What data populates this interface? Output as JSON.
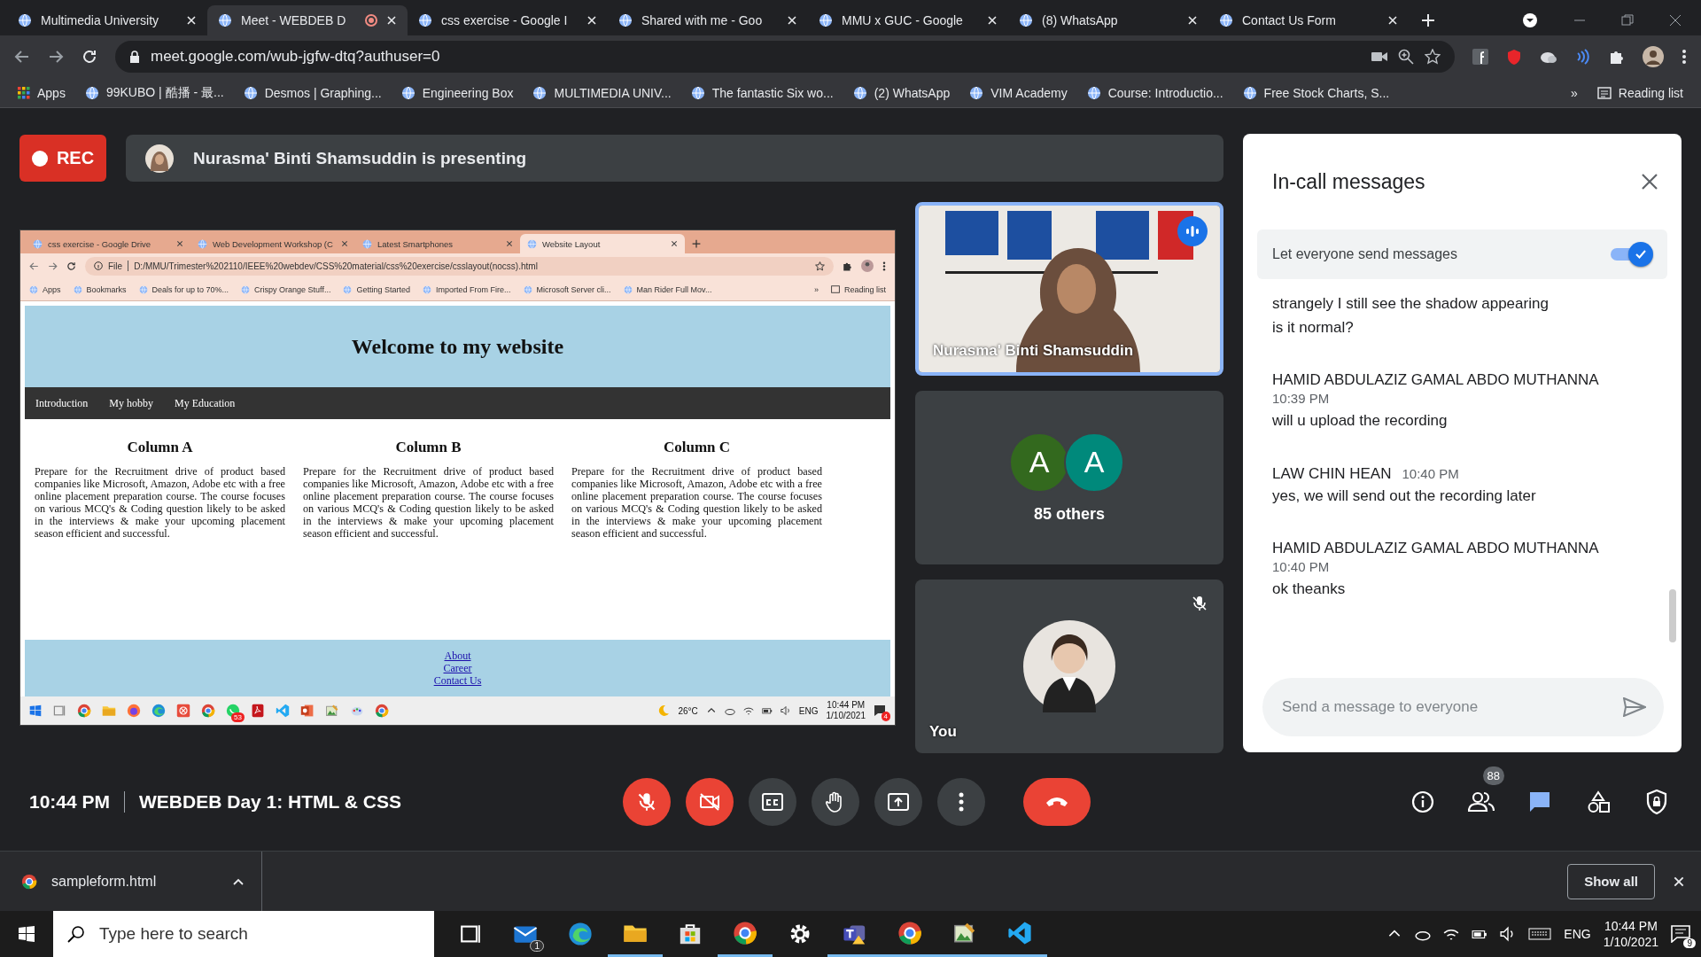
{
  "browser": {
    "tabs": [
      {
        "title": "Multimedia University",
        "selected": false,
        "recording": false
      },
      {
        "title": "Meet - WEBDEB D",
        "selected": true,
        "recording": true
      },
      {
        "title": "css exercise - Google I",
        "selected": false,
        "recording": false
      },
      {
        "title": "Shared with me - Goo",
        "selected": false,
        "recording": false
      },
      {
        "title": "MMU x GUC - Google",
        "selected": false,
        "recording": false
      },
      {
        "title": "(8) WhatsApp",
        "selected": false,
        "recording": false
      },
      {
        "title": "Contact Us Form",
        "selected": false,
        "recording": false
      }
    ],
    "address": "meet.google.com/wub-jgfw-dtq?authuser=0",
    "bookmarks": [
      "Apps",
      "99KUBO | 酷播 - 最...",
      "Desmos | Graphing...",
      "Engineering Box",
      "MULTIMEDIA UNIV...",
      "The fantastic Six wo...",
      "(2) WhatsApp",
      "VIM Academy",
      "Course: Introductio...",
      "Free Stock Charts, S..."
    ],
    "more": "»",
    "reading_list": "Reading list"
  },
  "meet": {
    "recording_label": "REC",
    "presenter_banner": "Nurasma' Binti Shamsuddin is presenting",
    "shared_screen": {
      "tabs": [
        {
          "title": "css exercise - Google Drive",
          "selected": false
        },
        {
          "title": "Web Development Workshop (C",
          "selected": false
        },
        {
          "title": "Latest Smartphones",
          "selected": false
        },
        {
          "title": "Website Layout",
          "selected": true
        }
      ],
      "scheme": "File",
      "address": "D:/MMU/Trimester%202110/IEEE%20webdev/CSS%20material/css%20exercise/csslayout(nocss).html",
      "bookmarks": [
        "Apps",
        "Bookmarks",
        "Deals for up to 70%...",
        "Crispy Orange Stuff...",
        "Getting Started",
        "Imported From Fire...",
        "Microsoft Server cli...",
        "Man Rider Full Mov..."
      ],
      "more": "»",
      "reading_list": "Reading list",
      "heading": "Welcome to my website",
      "nav": [
        "Introduction",
        "My hobby",
        "My Education"
      ],
      "columns": [
        {
          "title": "Column A",
          "text": "Prepare for the Recruitment drive of product based companies like Microsoft, Amazon, Adobe etc with a free online placement preparation course. The course focuses on various MCQ's & Coding question likely to be asked in the interviews & make your upcoming placement season efficient and successful."
        },
        {
          "title": "Column B",
          "text": "Prepare for the Recruitment drive of product based companies like Microsoft, Amazon, Adobe etc with a free online placement preparation course. The course focuses on various MCQ's & Coding question likely to be asked in the interviews & make your upcoming placement season efficient and successful."
        },
        {
          "title": "Column C",
          "text": "Prepare for the Recruitment drive of product based companies like Microsoft, Amazon, Adobe etc with a free online placement preparation course. The course focuses on various MCQ's & Coding question likely to be asked in the interviews & make your upcoming placement season efficient and successful."
        }
      ],
      "footer_links": [
        "About",
        "Career",
        "Contact Us"
      ],
      "taskbar": {
        "badge": "53",
        "weather": "26°C",
        "language": "ENG",
        "time": "10:44 PM",
        "date": "1/10/2021",
        "notifications": "4"
      }
    },
    "tiles": [
      {
        "kind": "presenter",
        "name": "Nurasma' Binti Shamsuddin",
        "speaking": true
      },
      {
        "kind": "group",
        "label": "85 others",
        "avatars": [
          {
            "letter": "A",
            "color": "#33691e"
          },
          {
            "letter": "A",
            "color": "#00897b"
          }
        ]
      },
      {
        "kind": "self",
        "name": "You",
        "muted": true
      }
    ],
    "chat": {
      "title": "In-call messages",
      "setting": {
        "label": "Let everyone send messages",
        "on": true
      },
      "messages": [
        {
          "lines": [
            "strangely I still see the shadow appearing",
            "is it normal?"
          ]
        },
        {
          "sender": "HAMID ABDULAZIZ GAMAL ABDO MUTHANNA",
          "time": "10:39 PM",
          "lines": [
            "will u upload the recording"
          ]
        },
        {
          "sender": "LAW CHIN HEAN",
          "time": "10:40 PM",
          "lines": [
            "yes, we will send out the recording later"
          ]
        },
        {
          "sender": "HAMID ABDULAZIZ GAMAL ABDO MUTHANNA",
          "time": "10:40 PM",
          "lines": [
            "ok theanks"
          ]
        }
      ],
      "placeholder": "Send a message to everyone"
    },
    "clock": "10:44 PM",
    "meeting_title": "WEBDEB Day 1: HTML & CSS",
    "controls": [
      {
        "kind": "mic",
        "off": true
      },
      {
        "kind": "camera",
        "off": true
      },
      {
        "kind": "captions",
        "off": false
      },
      {
        "kind": "hand",
        "off": false
      },
      {
        "kind": "present",
        "off": false
      },
      {
        "kind": "more",
        "off": false
      },
      {
        "kind": "leave"
      }
    ],
    "side_buttons": [
      {
        "kind": "info",
        "selected": false
      },
      {
        "kind": "people",
        "selected": false,
        "badge": "88"
      },
      {
        "kind": "chat",
        "selected": true
      },
      {
        "kind": "activities",
        "selected": false
      },
      {
        "kind": "host",
        "selected": false
      }
    ]
  },
  "downloads": {
    "file": "sampleform.html",
    "show_all": "Show all"
  },
  "taskbar": {
    "search_placeholder": "Type here to search",
    "mail_badge": "1",
    "language": "ENG",
    "time": "10:44 PM",
    "date": "1/10/2021",
    "notifications": "9"
  }
}
